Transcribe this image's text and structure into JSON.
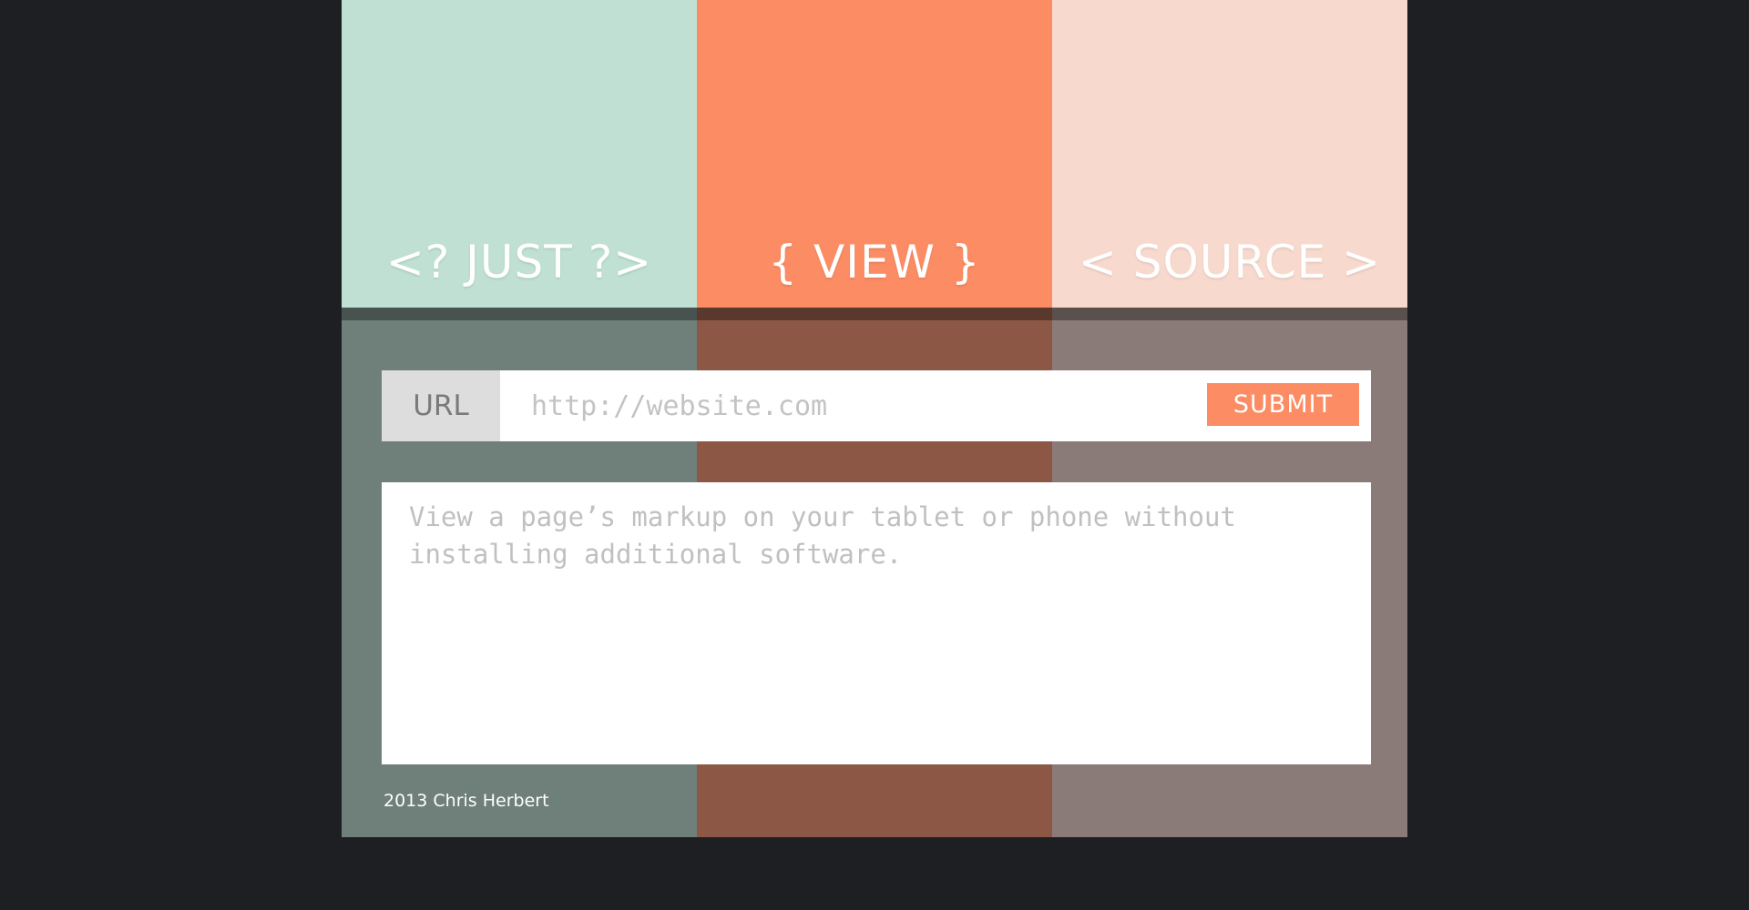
{
  "header": {
    "words": [
      "<? JUST ?>",
      "{ VIEW }",
      "< SOURCE >"
    ]
  },
  "colors": {
    "page_background": "#1e1f23",
    "column_top": [
      "#bfe0d3",
      "#fb8c64",
      "#f8d9ce"
    ],
    "column_bottom": [
      "#6f7f7a",
      "#8c5744",
      "#8b7b78"
    ],
    "accent": "#fb8c64"
  },
  "form": {
    "url_label": "URL",
    "url_placeholder": "http://website.com",
    "submit_label": "SUBMIT"
  },
  "output": {
    "placeholder_text": "View a page’s markup on your tablet or phone without installing additional software."
  },
  "footer": {
    "text": "2013 Chris Herbert"
  }
}
